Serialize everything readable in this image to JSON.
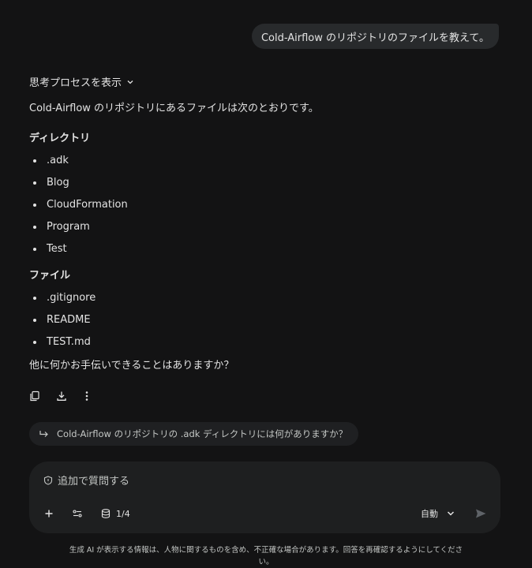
{
  "user_message": "Cold-Airflow のリポジトリのファイルを教えて。",
  "thinking_toggle": "思考プロセスを表示",
  "answer": {
    "intro": "Cold-Airflow のリポジトリにあるファイルは次のとおりです。",
    "dirs_heading": "ディレクトリ",
    "dirs": [
      ".adk",
      "Blog",
      "CloudFormation",
      "Program",
      "Test"
    ],
    "files_heading": "ファイル",
    "files": [
      ".gitignore",
      "README",
      "TEST.md"
    ],
    "closing": "他に何かお手伝いできることはありますか？"
  },
  "suggestion": "Cold-Airflow のリポジトリの .adk ディレクトリには何がありますか？",
  "composer": {
    "placeholder": "追加で質問する",
    "source_count": "1/4",
    "mode": "自動"
  },
  "disclaimer": "生成 AI が表示する情報は、人物に関するものを含め、不正確な場合があります。回答を再確認するようにしてください。",
  "icons": {
    "thinking": "chevron-down-icon",
    "copy": "copy-icon",
    "download": "download-icon",
    "more": "more-vert-icon",
    "suggestion": "reply-arrow-icon",
    "placeholder": "shield-icon",
    "add": "plus-icon",
    "tools": "tools-icon",
    "sources": "database-icon",
    "mode": "chevron-down-icon",
    "send": "send-icon"
  }
}
